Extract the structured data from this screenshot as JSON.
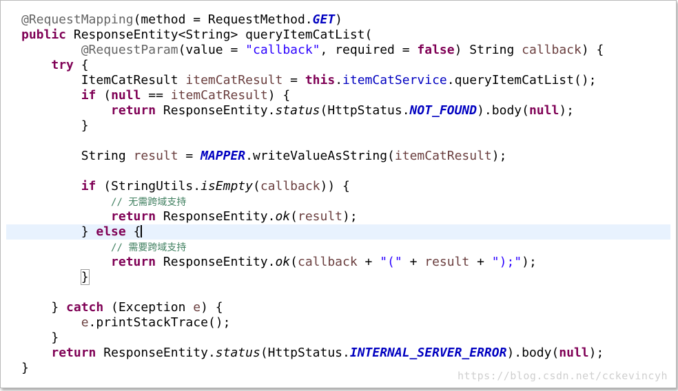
{
  "editor": {
    "lines": [
      [
        [
          "ann",
          "@RequestMapping"
        ],
        [
          "",
          "(method = RequestMethod."
        ],
        [
          "cst",
          "GET"
        ],
        [
          "",
          ")"
        ]
      ],
      [
        [
          "kw",
          "public"
        ],
        [
          "",
          " ResponseEntity<String> queryItemCatList("
        ]
      ],
      [
        [
          "",
          "        "
        ],
        [
          "ann",
          "@RequestParam"
        ],
        [
          "",
          "(value = "
        ],
        [
          "str",
          "\"callback\""
        ],
        [
          "",
          ", required = "
        ],
        [
          "kw",
          "false"
        ],
        [
          "",
          ") String "
        ],
        [
          "par",
          "callback"
        ],
        [
          "",
          ") {"
        ]
      ],
      [
        [
          "",
          "    "
        ],
        [
          "kw",
          "try"
        ],
        [
          "",
          " {"
        ]
      ],
      [
        [
          "",
          "        ItemCatResult "
        ],
        [
          "par",
          "itemCatResult"
        ],
        [
          "",
          " = "
        ],
        [
          "kw",
          "this"
        ],
        [
          "",
          "."
        ],
        [
          "fld",
          "itemCatService"
        ],
        [
          "",
          ".queryItemCatList();"
        ]
      ],
      [
        [
          "",
          "        "
        ],
        [
          "kw",
          "if"
        ],
        [
          "",
          " ("
        ],
        [
          "kw",
          "null"
        ],
        [
          "",
          " == "
        ],
        [
          "par",
          "itemCatResult"
        ],
        [
          "",
          ") {"
        ]
      ],
      [
        [
          "",
          "            "
        ],
        [
          "kw",
          "return"
        ],
        [
          "",
          " ResponseEntity."
        ],
        [
          "sm",
          "status"
        ],
        [
          "",
          "(HttpStatus."
        ],
        [
          "cst",
          "NOT_FOUND"
        ],
        [
          "",
          ").body("
        ],
        [
          "kw",
          "null"
        ],
        [
          "",
          ");"
        ]
      ],
      [
        [
          "",
          "        }"
        ]
      ],
      [],
      [
        [
          "",
          "        String "
        ],
        [
          "par",
          "result"
        ],
        [
          "",
          " = "
        ],
        [
          "cst",
          "MAPPER"
        ],
        [
          "",
          ".writeValueAsString("
        ],
        [
          "par",
          "itemCatResult"
        ],
        [
          "",
          ");"
        ]
      ],
      [],
      [
        [
          "",
          "        "
        ],
        [
          "kw",
          "if"
        ],
        [
          "",
          " (StringUtils."
        ],
        [
          "sm",
          "isEmpty"
        ],
        [
          "",
          "("
        ],
        [
          "par",
          "callback"
        ],
        [
          "",
          "))"
        ],
        [
          "",
          " {"
        ]
      ],
      [
        [
          "",
          "            "
        ],
        [
          "cmt",
          "// 无需跨域支持"
        ]
      ],
      [
        [
          "",
          "            "
        ],
        [
          "kw",
          "return"
        ],
        [
          "",
          " ResponseEntity."
        ],
        [
          "sm",
          "ok"
        ],
        [
          "",
          "("
        ],
        [
          "par",
          "result"
        ],
        [
          "",
          ");"
        ]
      ],
      [
        [
          "",
          "        } "
        ],
        [
          "kw",
          "else"
        ],
        [
          "",
          " {"
        ],
        [
          "caret",
          ""
        ]
      ],
      [
        [
          "",
          "            "
        ],
        [
          "cmt",
          "// 需要跨域支持"
        ]
      ],
      [
        [
          "",
          "            "
        ],
        [
          "kw",
          "return"
        ],
        [
          "",
          " ResponseEntity."
        ],
        [
          "sm",
          "ok"
        ],
        [
          "",
          "("
        ],
        [
          "par",
          "callback"
        ],
        [
          "",
          " + "
        ],
        [
          "str",
          "\"(\""
        ],
        [
          "",
          " + "
        ],
        [
          "par",
          "result"
        ],
        [
          "",
          " + "
        ],
        [
          "str",
          "\");\""
        ],
        [
          "",
          ");"
        ]
      ],
      [
        [
          "",
          "        "
        ],
        [
          "bracket",
          "}"
        ]
      ],
      [],
      [
        [
          "",
          "    } "
        ],
        [
          "kw",
          "catch"
        ],
        [
          "",
          " (Exception "
        ],
        [
          "par",
          "e"
        ],
        [
          "",
          ") {"
        ]
      ],
      [
        [
          "",
          "        "
        ],
        [
          "par",
          "e"
        ],
        [
          "",
          ".printStackTrace();"
        ]
      ],
      [
        [
          "",
          "    }"
        ]
      ],
      [
        [
          "",
          "    "
        ],
        [
          "kw",
          "return"
        ],
        [
          "",
          " ResponseEntity."
        ],
        [
          "sm",
          "status"
        ],
        [
          "",
          "(HttpStatus."
        ],
        [
          "cst",
          "INTERNAL_SERVER_ERROR"
        ],
        [
          "",
          ").body("
        ],
        [
          "kw",
          "null"
        ],
        [
          "",
          ");"
        ]
      ],
      [
        [
          "",
          "}"
        ]
      ]
    ],
    "current_line_index": 14
  },
  "watermark": "https://blog.csdn.net/cckevincyh",
  "colors": {
    "keyword": "#7f0055",
    "annotation": "#646464",
    "string": "#2a00ff",
    "field": "#0000c0",
    "parameter": "#6a3e3e",
    "comment": "#3f7f5f",
    "current_line": "#e8f2fe"
  }
}
